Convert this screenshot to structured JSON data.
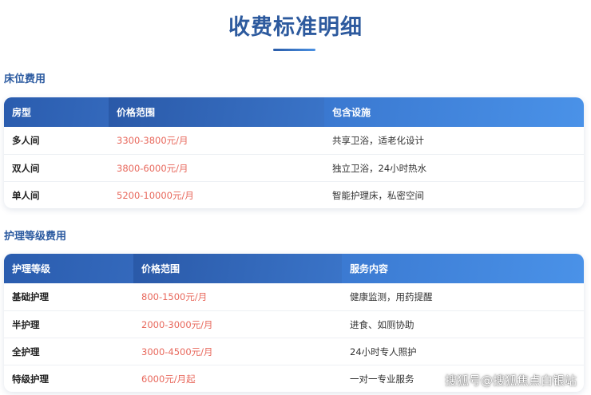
{
  "page": {
    "title": "收费标准明细"
  },
  "bed_section": {
    "heading": "床位费用",
    "headers": [
      "房型",
      "价格范围",
      "包含设施"
    ],
    "rows": [
      [
        "多人间",
        "3300-3800元/月",
        "共享卫浴，适老化设计"
      ],
      [
        "双人间",
        "3800-6000元/月",
        "独立卫浴，24小时热水"
      ],
      [
        "单人间",
        "5200-10000元/月",
        "智能护理床，私密空间"
      ]
    ]
  },
  "care_section": {
    "heading": "护理等级费用",
    "headers": [
      "护理等级",
      "价格范围",
      "服务内容"
    ],
    "rows": [
      [
        "基础护理",
        "800-1500元/月",
        "健康监测，用药提醒"
      ],
      [
        "半护理",
        "2000-3000元/月",
        "进食、如厕协助"
      ],
      [
        "全护理",
        "3000-4500元/月",
        "24小时专人照护"
      ],
      [
        "特级护理",
        "6000元/月起",
        "一对一专业服务"
      ]
    ]
  },
  "watermark": {
    "text": "搜狐号@搜狐焦点白银站"
  },
  "colors": {
    "title": "#2d5a9e",
    "header_start": "#2b5fb0",
    "header_end": "#4a92e8",
    "price": "#e8685c"
  }
}
